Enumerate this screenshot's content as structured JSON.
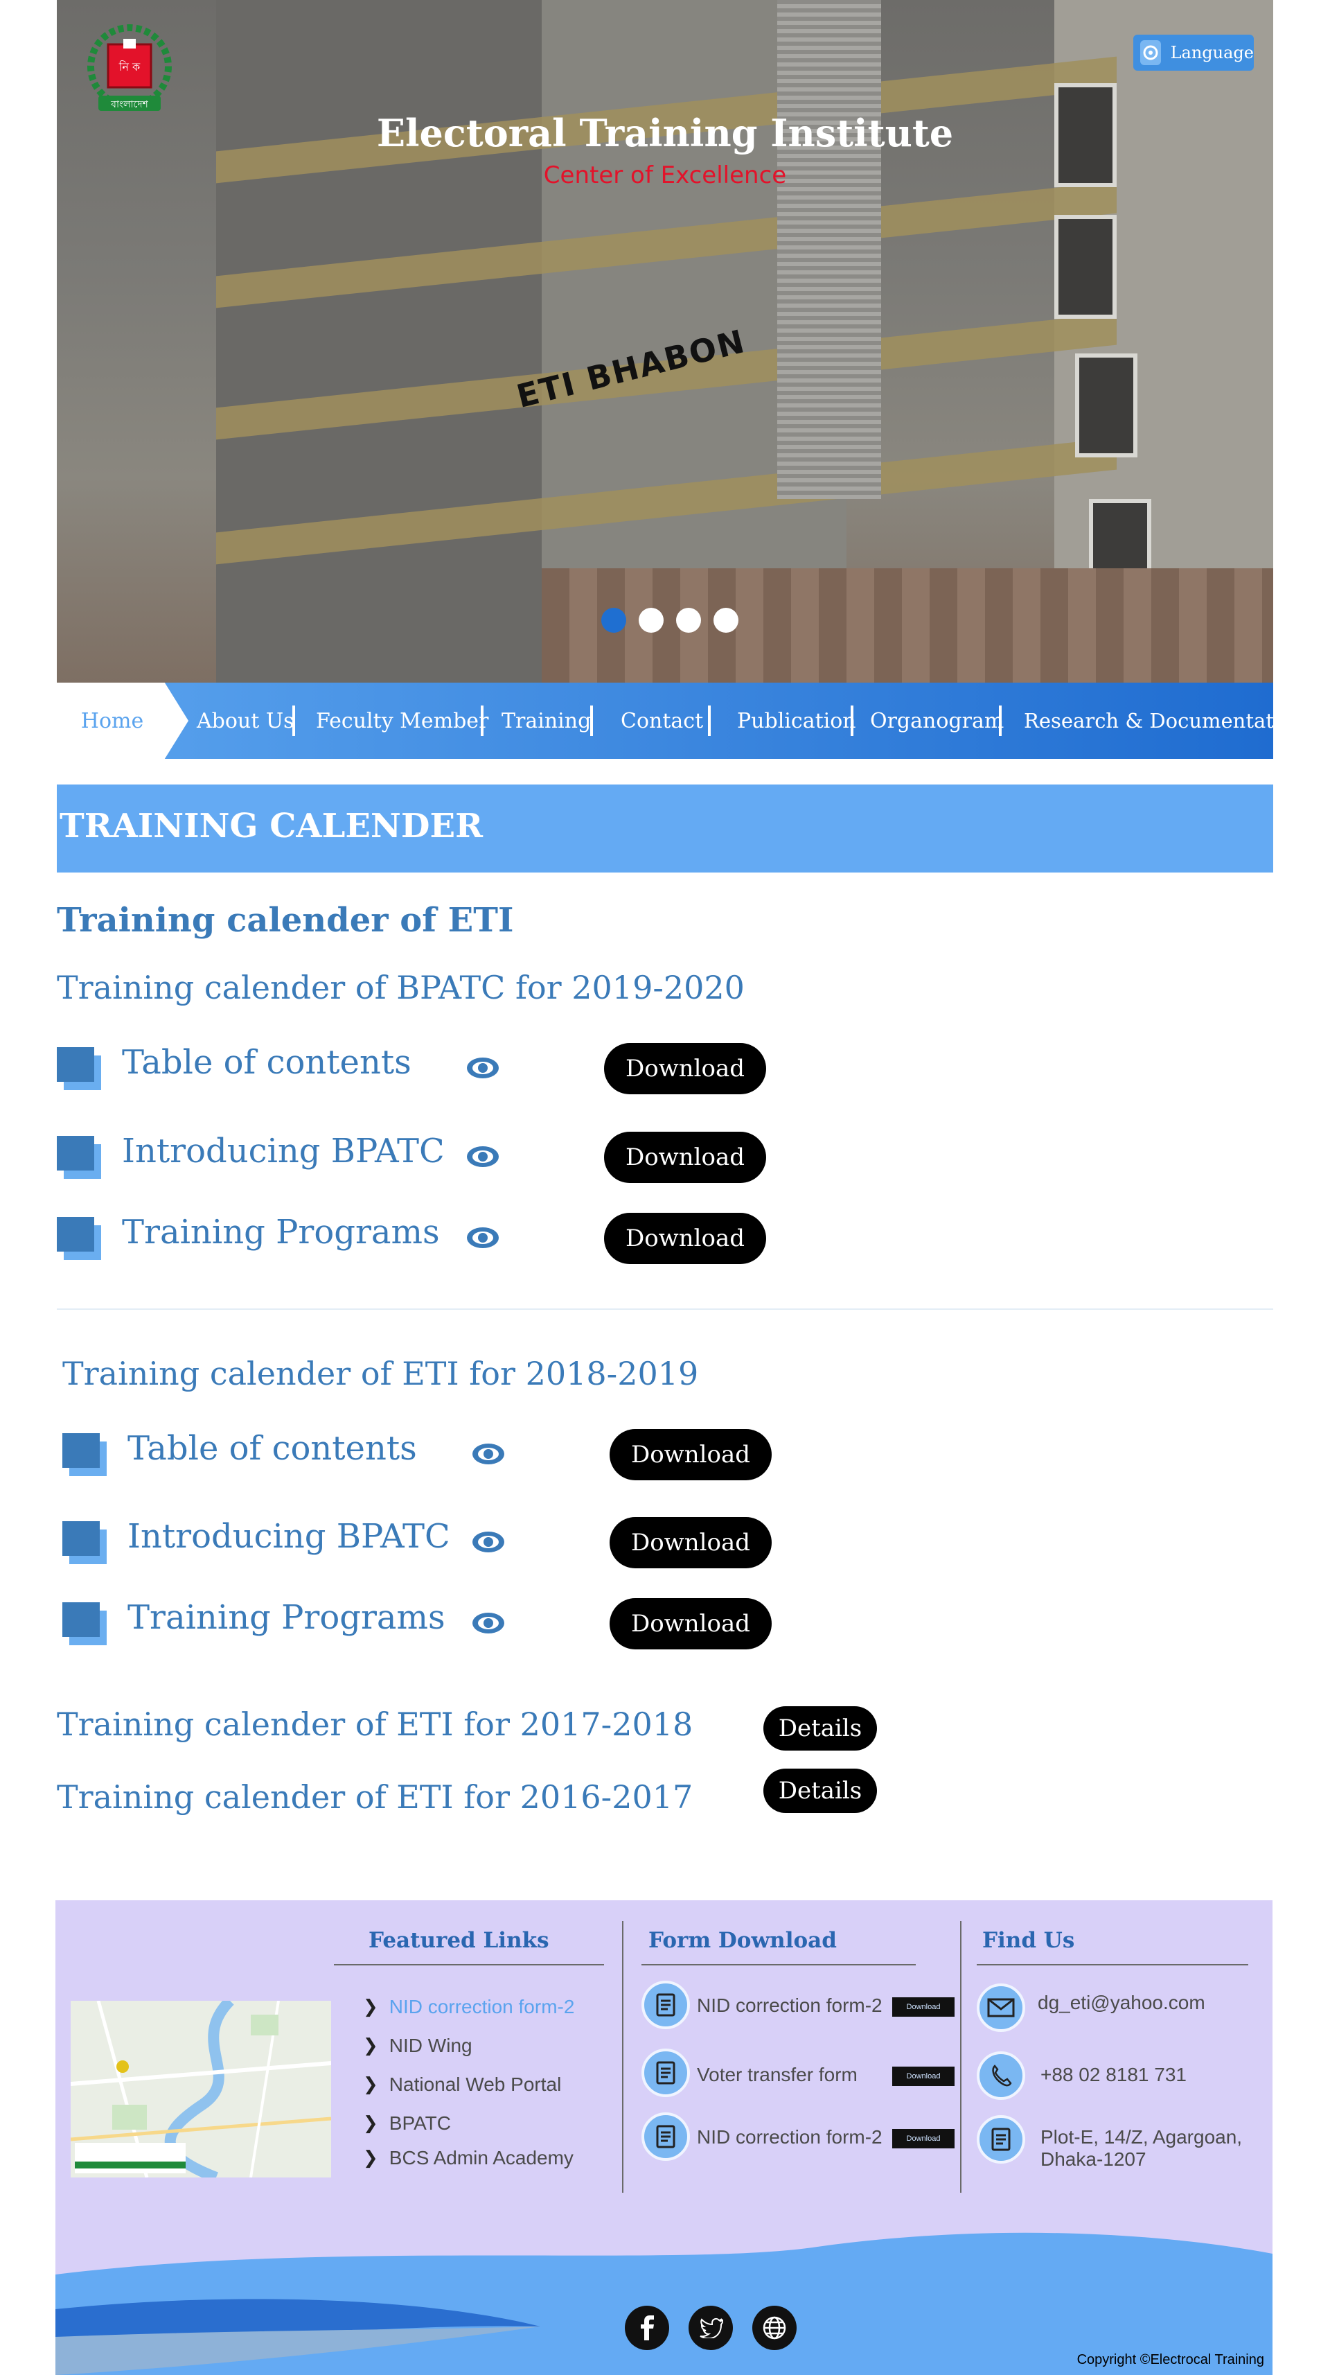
{
  "header": {
    "title": "Electoral Training Institute",
    "subtitle": "Center of Excellence",
    "building_sign": "ETI BHABON",
    "language_label": "Language",
    "logo_text": "বাংলাদেশ",
    "logo_box_text": "নি ক",
    "slider_dots": 4,
    "active_dot": 0
  },
  "nav": {
    "items": [
      {
        "label": "Home"
      },
      {
        "label": "About Us"
      },
      {
        "label": "Feculty Member"
      },
      {
        "label": "Training"
      },
      {
        "label": "Contact"
      },
      {
        "label": "Publication"
      },
      {
        "label": "Organogram"
      },
      {
        "label": "Research & Documentation"
      }
    ]
  },
  "main": {
    "banner": "TRAINING CALENDER",
    "heading": "Training calender of ETI",
    "section1": {
      "title": "Training calender of BPATC for 2019-2020",
      "rows": [
        {
          "label": "Table of contents",
          "button": "Download"
        },
        {
          "label": "Introducing BPATC",
          "button": "Download"
        },
        {
          "label": "Training Programs",
          "button": "Download"
        }
      ]
    },
    "section2": {
      "title": "Training calender of ETI for 2018-2019",
      "rows": [
        {
          "label": "Table of contents",
          "button": "Download"
        },
        {
          "label": "Introducing BPATC",
          "button": "Download"
        },
        {
          "label": "Training Programs",
          "button": "Download"
        }
      ]
    },
    "section3": {
      "title": "Training calender of ETI for 2017-2018",
      "button": "Details"
    },
    "section4": {
      "title": "Training calender of ETI for 2016-2017",
      "button": "Details"
    }
  },
  "footer": {
    "featured": {
      "title": "Featured Links",
      "links": [
        "NID correction form-2",
        "NID Wing",
        "National Web Portal",
        "BPATC",
        "BCS Admin Academy"
      ]
    },
    "forms": {
      "title": "Form Download",
      "items": [
        {
          "label": "NID correction form-2",
          "button": "Download"
        },
        {
          "label": "Voter transfer form",
          "button": "Download"
        },
        {
          "label": "NID correction form-2",
          "button": "Download"
        }
      ]
    },
    "find": {
      "title": "Find Us",
      "email": "dg_eti@yahoo.com",
      "phone": "+88 02 8181 731",
      "address_line1": "Plot-E, 14/Z, Agargoan,",
      "address_line2": "Dhaka-1207"
    },
    "social": [
      "facebook-icon",
      "twitter-icon",
      "globe-icon"
    ],
    "copyright": "Copyright ©Electrocal Training"
  },
  "colors": {
    "primary_blue": "#3a7ab8",
    "banner_blue": "#64aaf3",
    "nav_dark": "#1f6cd0",
    "footer_bg": "#d8d0f8",
    "accent_red": "#e3122a"
  }
}
